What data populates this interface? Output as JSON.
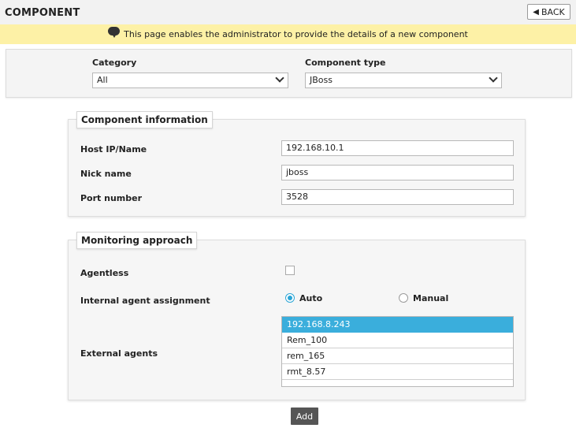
{
  "header": {
    "title": "COMPONENT",
    "back_label": "BACK"
  },
  "info": {
    "message": "This page enables the administrator to provide the details of a new component"
  },
  "filters": {
    "category_label": "Category",
    "category_value": "All",
    "type_label": "Component type",
    "type_value": "JBoss"
  },
  "component_info": {
    "legend": "Component information",
    "host_label": "Host IP/Name",
    "host_value": "192.168.10.1",
    "nick_label": "Nick name",
    "nick_value": "jboss",
    "port_label": "Port number",
    "port_value": "3528"
  },
  "monitoring": {
    "legend": "Monitoring approach",
    "agentless_label": "Agentless",
    "agentless_checked": false,
    "assignment_label": "Internal agent assignment",
    "auto_label": "Auto",
    "manual_label": "Manual",
    "selected_assignment": "Auto",
    "external_label": "External agents",
    "external_agents": [
      "192.168.8.243",
      "Rem_100",
      "rem_165",
      "rmt_8.57"
    ],
    "selected_agent": "192.168.8.243"
  },
  "actions": {
    "add_label": "Add"
  },
  "colors": {
    "info_bg": "#fdf1a6",
    "selected_item": "#3aaedc",
    "button_dark": "#555555",
    "radio_accent": "#2aa5d6"
  }
}
